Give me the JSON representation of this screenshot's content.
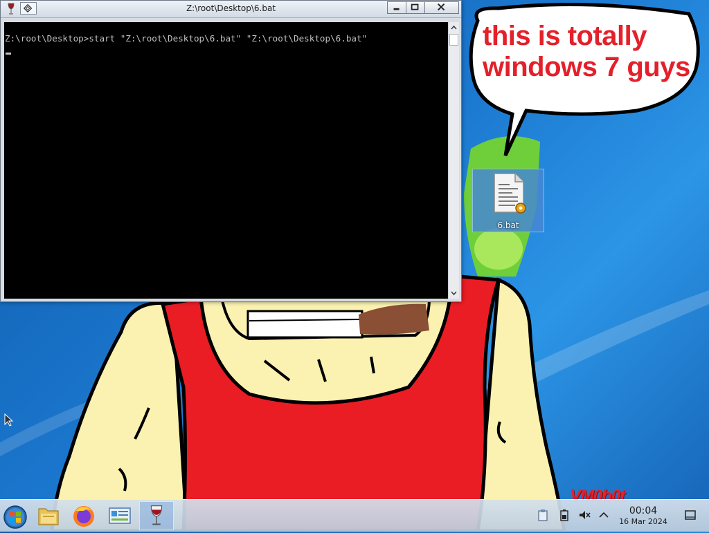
{
  "window": {
    "title": "Z:\\root\\Desktop\\6.bat",
    "console_text": "Z:\\root\\Desktop>start \"Z:\\root\\Desktop\\6.bat\" \"Z:\\root\\Desktop\\6.bat\""
  },
  "wallpaper": {
    "bubble_text": "this is totally windows 7 guys",
    "signature": "VM0b0t"
  },
  "desktop": {
    "icons": [
      {
        "label": "6.bat",
        "icon": "batch-file-icon"
      }
    ]
  },
  "taskbar": {
    "items": [
      {
        "name": "start-button",
        "icon": "windows-orb-icon"
      },
      {
        "name": "file-manager",
        "icon": "folder-icon"
      },
      {
        "name": "firefox",
        "icon": "firefox-icon"
      },
      {
        "name": "control-panel",
        "icon": "control-panel-icon"
      },
      {
        "name": "wine-console",
        "icon": "wine-glass-icon",
        "active": true
      }
    ],
    "tray": [
      "clipboard-icon",
      "battery-icon",
      "volume-muted-icon",
      "chevron-up-icon",
      "show-desktop-icon"
    ],
    "clock": {
      "time": "00:04",
      "date": "16 Mar 2024"
    }
  },
  "colors": {
    "accent_red": "#e4202a",
    "console_bg": "#000000",
    "console_fg": "#c0c0c0"
  }
}
